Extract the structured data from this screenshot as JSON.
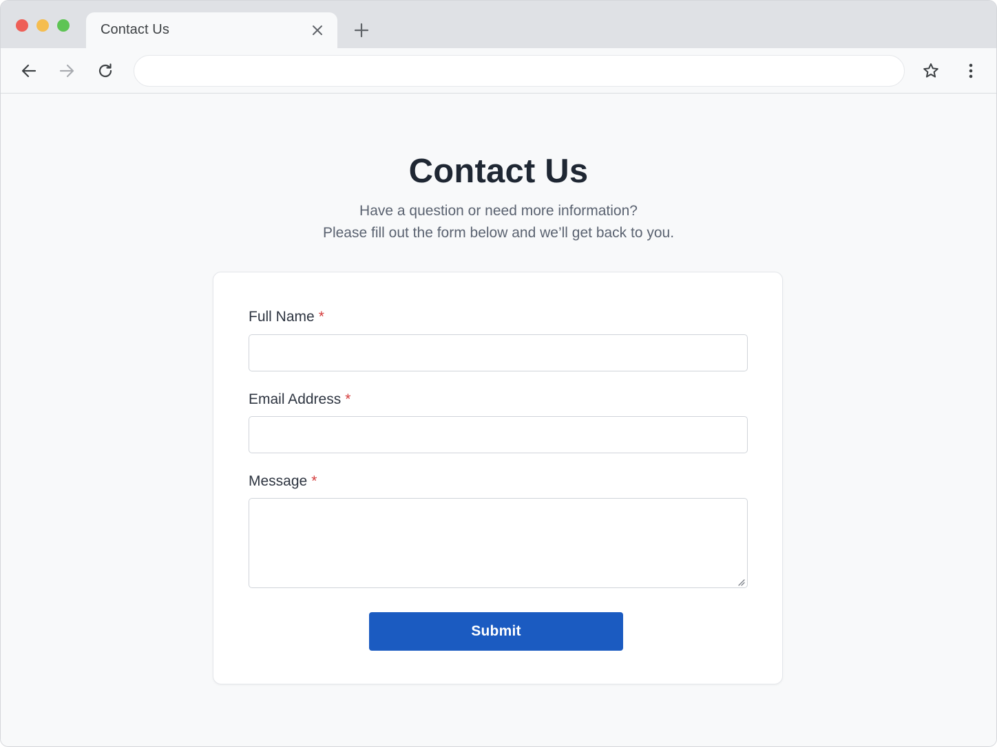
{
  "browser": {
    "tab_title": "Contact Us",
    "address_value": "",
    "icons": {
      "close": "close-icon",
      "new_tab": "plus-icon",
      "back": "arrow-left-icon",
      "forward": "arrow-right-icon",
      "reload": "reload-icon",
      "bookmark": "star-icon",
      "menu": "kebab-menu-icon"
    },
    "traffic_light_colors": [
      "#ee5f57",
      "#f5bd4f",
      "#5ec454"
    ]
  },
  "page": {
    "title": "Contact Us",
    "subtitle_line1": "Have a question or need more information?",
    "subtitle_line2": "Please fill out the form below and we’ll get back to you."
  },
  "form": {
    "required_marker": "*",
    "full_name": {
      "label": "Full Name",
      "value": ""
    },
    "email": {
      "label": "Email Address",
      "value": ""
    },
    "message": {
      "label": "Message",
      "value": ""
    },
    "submit_label": "Submit"
  },
  "colors": {
    "accent": "#1b5bc1",
    "required": "#d43b3b",
    "heading": "#1f2733"
  }
}
